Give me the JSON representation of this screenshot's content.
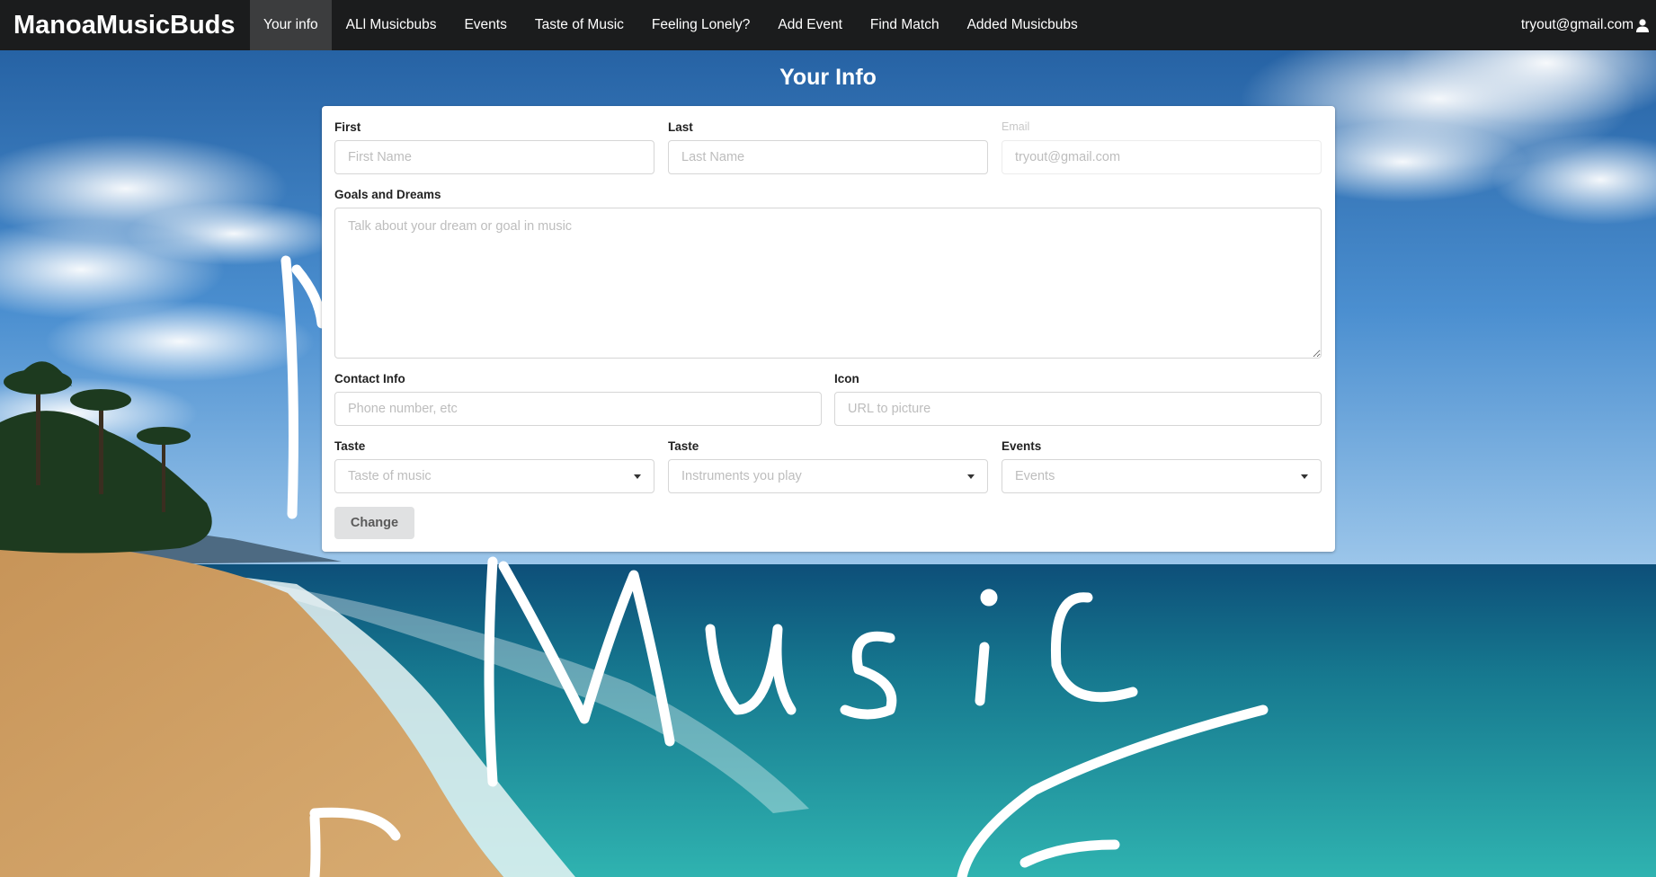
{
  "navbar": {
    "brand": "ManoaMusicBuds",
    "items": [
      {
        "label": "Your info",
        "active": true
      },
      {
        "label": "ALl Musicbubs",
        "active": false
      },
      {
        "label": "Events",
        "active": false
      },
      {
        "label": "Taste of Music",
        "active": false
      },
      {
        "label": "Feeling Lonely?",
        "active": false
      },
      {
        "label": "Add Event",
        "active": false
      },
      {
        "label": "Find Match",
        "active": false
      },
      {
        "label": "Added Musicbubs",
        "active": false
      }
    ],
    "user_email": "tryout@gmail.com",
    "user_icon": "user-icon"
  },
  "page": {
    "title": "Your Info"
  },
  "form": {
    "first": {
      "label": "First",
      "placeholder": "First Name",
      "value": ""
    },
    "last": {
      "label": "Last",
      "placeholder": "Last Name",
      "value": ""
    },
    "email": {
      "label": "Email",
      "placeholder": "tryout@gmail.com",
      "value": "",
      "disabled": true
    },
    "goals": {
      "label": "Goals and Dreams",
      "placeholder": "Talk about your dream or goal in music",
      "value": ""
    },
    "contact": {
      "label": "Contact Info",
      "placeholder": "Phone number, etc",
      "value": ""
    },
    "icon": {
      "label": "Icon",
      "placeholder": "URL to picture",
      "value": ""
    },
    "taste_music": {
      "label": "Taste",
      "placeholder": "Taste of music"
    },
    "taste_instruments": {
      "label": "Taste",
      "placeholder": "Instruments you play"
    },
    "events": {
      "label": "Events",
      "placeholder": "Events"
    },
    "submit_label": "Change"
  },
  "background": {
    "description_icon": "beach-background",
    "overlay_text": "Music",
    "colors": {
      "sky": "#2f6fb0",
      "sea": "#1e9aa0",
      "sand": "#c99a5e"
    }
  }
}
